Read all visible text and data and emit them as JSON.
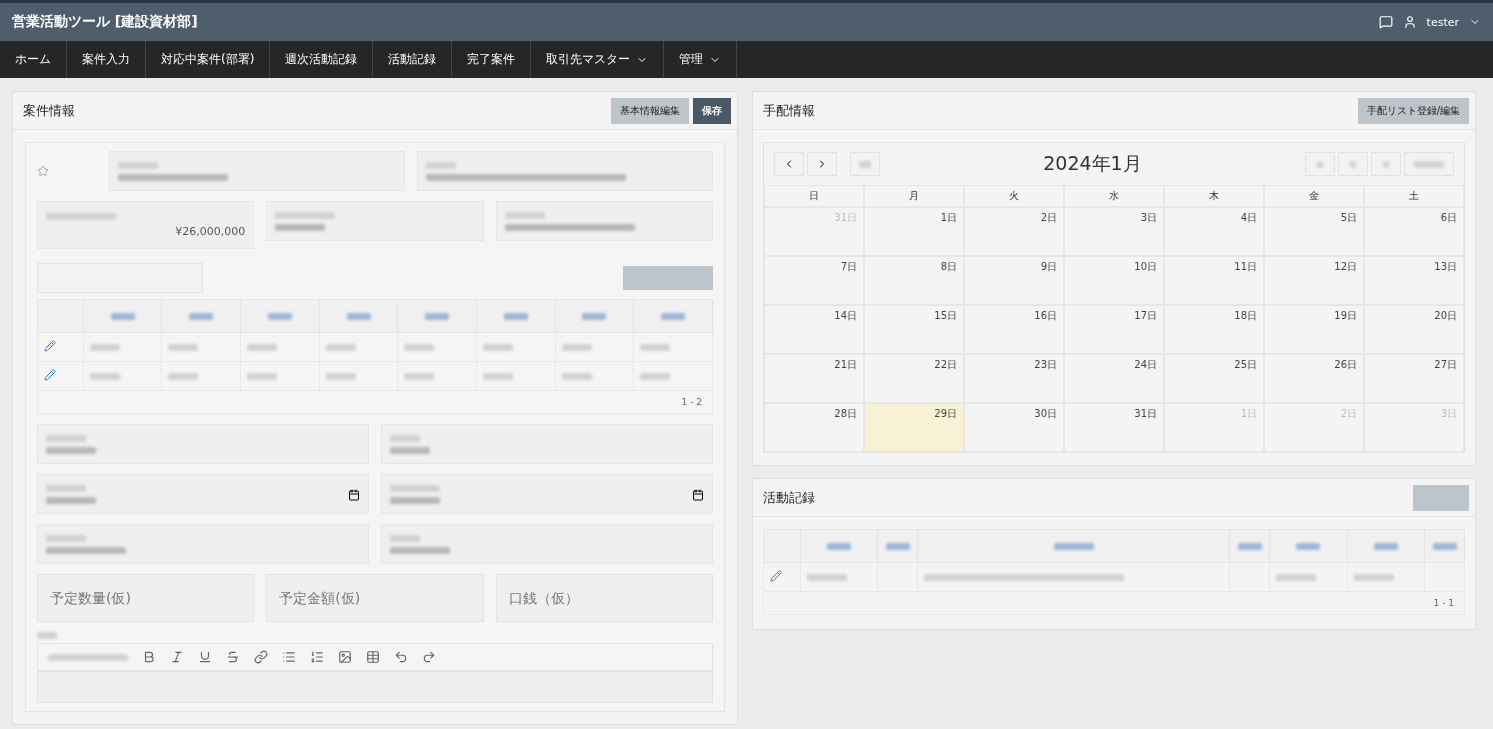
{
  "app": {
    "title": "営業活動ツール [建設資材部]",
    "user": "tester"
  },
  "nav": [
    {
      "label": "ホーム",
      "dropdown": false
    },
    {
      "label": "案件入力",
      "dropdown": false
    },
    {
      "label": "対応中案件(部署)",
      "dropdown": false
    },
    {
      "label": "週次活動記録",
      "dropdown": false
    },
    {
      "label": "活動記録",
      "dropdown": false
    },
    {
      "label": "完了案件",
      "dropdown": false
    },
    {
      "label": "取引先マスター",
      "dropdown": true
    },
    {
      "label": "管理",
      "dropdown": true
    }
  ],
  "case_panel": {
    "title": "案件情報",
    "buttons": [
      {
        "label": "基本情報編集",
        "kind": "secondary"
      },
      {
        "label": "保存",
        "kind": "primary"
      }
    ],
    "amount": "¥26,000,000",
    "table_footer": "1 - 2",
    "estimates": [
      {
        "placeholder": "予定数量(仮)"
      },
      {
        "placeholder": "予定金額(仮)"
      },
      {
        "placeholder": "口銭（仮）"
      }
    ]
  },
  "arrangement_panel": {
    "title": "手配情報",
    "button": "手配リスト登録/編集",
    "calendar": {
      "title": "2024年1月",
      "weekdays": [
        "日",
        "月",
        "火",
        "水",
        "木",
        "金",
        "土"
      ],
      "days": [
        {
          "label": "31日",
          "other_month": true,
          "today": false
        },
        {
          "label": "1日",
          "other_month": false,
          "today": false
        },
        {
          "label": "2日",
          "other_month": false,
          "today": false
        },
        {
          "label": "3日",
          "other_month": false,
          "today": false
        },
        {
          "label": "4日",
          "other_month": false,
          "today": false
        },
        {
          "label": "5日",
          "other_month": false,
          "today": false
        },
        {
          "label": "6日",
          "other_month": false,
          "today": false
        },
        {
          "label": "7日",
          "other_month": false,
          "today": false
        },
        {
          "label": "8日",
          "other_month": false,
          "today": false
        },
        {
          "label": "9日",
          "other_month": false,
          "today": false
        },
        {
          "label": "10日",
          "other_month": false,
          "today": false
        },
        {
          "label": "11日",
          "other_month": false,
          "today": false
        },
        {
          "label": "12日",
          "other_month": false,
          "today": false
        },
        {
          "label": "13日",
          "other_month": false,
          "today": false
        },
        {
          "label": "14日",
          "other_month": false,
          "today": false
        },
        {
          "label": "15日",
          "other_month": false,
          "today": false
        },
        {
          "label": "16日",
          "other_month": false,
          "today": false
        },
        {
          "label": "17日",
          "other_month": false,
          "today": false
        },
        {
          "label": "18日",
          "other_month": false,
          "today": false
        },
        {
          "label": "19日",
          "other_month": false,
          "today": false
        },
        {
          "label": "20日",
          "other_month": false,
          "today": false
        },
        {
          "label": "21日",
          "other_month": false,
          "today": false
        },
        {
          "label": "22日",
          "other_month": false,
          "today": false
        },
        {
          "label": "23日",
          "other_month": false,
          "today": false
        },
        {
          "label": "24日",
          "other_month": false,
          "today": false
        },
        {
          "label": "25日",
          "other_month": false,
          "today": false
        },
        {
          "label": "26日",
          "other_month": false,
          "today": false
        },
        {
          "label": "27日",
          "other_month": false,
          "today": false
        },
        {
          "label": "28日",
          "other_month": false,
          "today": false
        },
        {
          "label": "29日",
          "other_month": false,
          "today": true
        },
        {
          "label": "30日",
          "other_month": false,
          "today": false
        },
        {
          "label": "31日",
          "other_month": false,
          "today": false
        },
        {
          "label": "1日",
          "other_month": true,
          "today": false
        },
        {
          "label": "2日",
          "other_month": true,
          "today": false
        },
        {
          "label": "3日",
          "other_month": true,
          "today": false
        }
      ]
    }
  },
  "activity_panel": {
    "title": "活動記録",
    "table_footer": "1 - 1"
  }
}
